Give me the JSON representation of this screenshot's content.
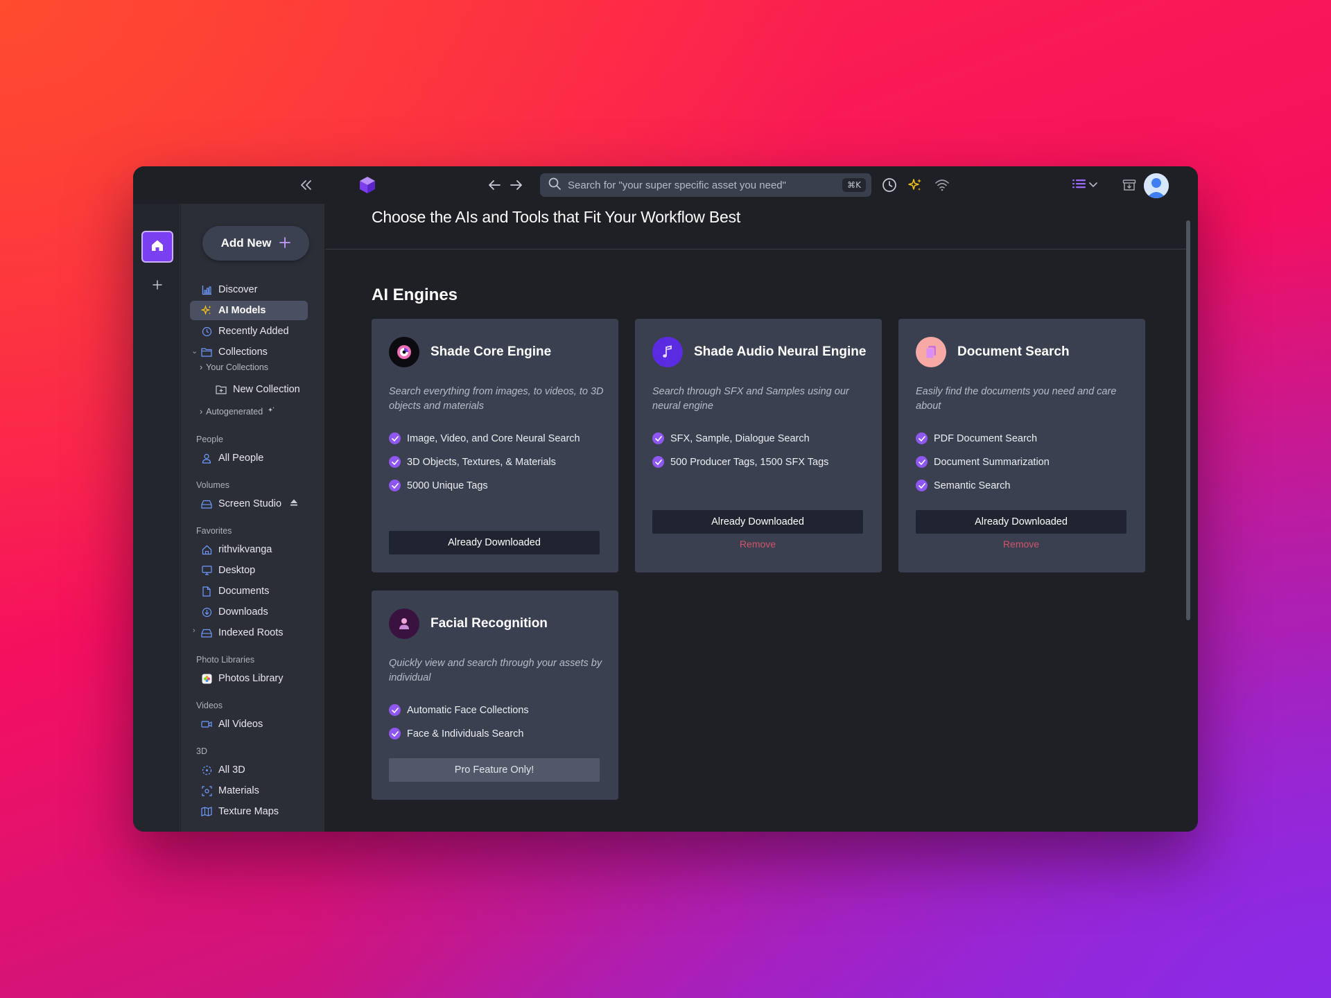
{
  "topbar": {
    "search_placeholder": "Search for \"your super specific asset you need\"",
    "search_shortcut": "⌘K"
  },
  "sidebar": {
    "add_new_label": "Add New",
    "items": {
      "discover": "Discover",
      "ai_models": "AI Models",
      "recently_added": "Recently Added",
      "collections": "Collections",
      "your_collections": "Your Collections",
      "new_collection": "New Collection",
      "autogenerated": "Autogenerated"
    },
    "people": {
      "heading": "People",
      "all_people": "All People"
    },
    "volumes": {
      "heading": "Volumes",
      "screen_studio": "Screen Studio"
    },
    "favorites": {
      "heading": "Favorites",
      "items": [
        "rithvikvanga",
        "Desktop",
        "Documents",
        "Downloads",
        "Indexed Roots"
      ]
    },
    "photo_libraries": {
      "heading": "Photo Libraries",
      "photos_library": "Photos Library"
    },
    "videos": {
      "heading": "Videos",
      "all_videos": "All Videos"
    },
    "three_d": {
      "heading": "3D",
      "items": [
        "All 3D",
        "Materials",
        "Texture Maps"
      ]
    }
  },
  "main": {
    "page_title": "Choose the AIs and Tools that Fit Your Workflow Best",
    "section_title": "AI Engines",
    "cards": [
      {
        "title": "Shade Core Engine",
        "icon": "shade-core-icon",
        "description": "Search everything from images, to videos, to 3D objects and materials",
        "features": [
          "Image, Video, and Core Neural Search",
          "3D Objects, Textures, & Materials",
          "5000 Unique Tags"
        ],
        "button": "Already Downloaded"
      },
      {
        "title": "Shade Audio Neural Engine",
        "icon": "music-note-icon",
        "description": "Search through SFX and Samples using our neural engine",
        "features": [
          "SFX, Sample, Dialogue Search",
          "500 Producer Tags, 1500 SFX Tags"
        ],
        "button": "Already Downloaded",
        "remove": "Remove"
      },
      {
        "title": "Document Search",
        "icon": "document-icon",
        "description": "Easily find the documents you need and care about",
        "features": [
          "PDF Document Search",
          "Document Summarization",
          "Semantic Search"
        ],
        "button": "Already Downloaded",
        "remove": "Remove"
      },
      {
        "title": "Facial Recognition",
        "icon": "person-icon",
        "description": "Quickly view and search through your assets by individual",
        "features": [
          "Automatic Face Collections",
          "Face & Individuals Search"
        ],
        "button": "Pro Feature Only!"
      }
    ]
  },
  "colors": {
    "accent": "#7a3ff0",
    "check": "#8f57f2",
    "remove": "#d0546a",
    "card": "#3a4050",
    "window": "#1f2026"
  }
}
